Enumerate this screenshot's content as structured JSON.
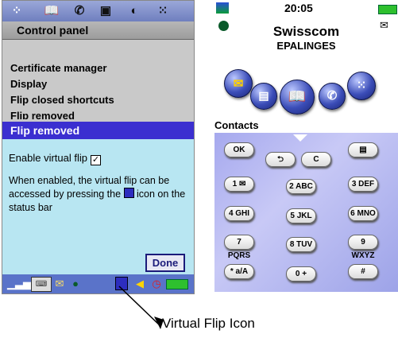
{
  "left_phone": {
    "top_bar_icons": [
      "app-launcher-icon",
      "book-icon",
      "phone-icon",
      "calendar-icon",
      "globe-icon",
      "grid-icon"
    ],
    "title": "Control panel",
    "menu_items": [
      "Certificate manager",
      "Display",
      "Flip closed shortcuts",
      "Flip removed"
    ],
    "dialog": {
      "title": "Flip removed",
      "enable_label": "Enable virtual flip",
      "enable_checked": true,
      "description_part1": "When enabled, the virtual flip can be accessed by pressing the",
      "description_part2": "icon on the status bar",
      "done_label": "Done"
    },
    "status_icons": [
      "signal-icon",
      "keyboard-icon",
      "email-icon",
      "globe-icon",
      "virtual-flip-icon",
      "sound-icon",
      "clock-icon",
      "battery-icon"
    ]
  },
  "right_phone": {
    "time": "20:05",
    "provider": "Swisscom",
    "location": "EPALINGES",
    "apps": [
      "messages-icon",
      "contacts-card-icon",
      "book-icon",
      "phone-icon",
      "grid-icon"
    ],
    "section_label": "Contacts",
    "keys": [
      {
        "label": "OK"
      },
      {
        "label": "⮌"
      },
      {
        "label": "C"
      },
      {
        "label": "▤"
      },
      {
        "label": "1 ✉"
      },
      {
        "label": "2 ABC"
      },
      {
        "label": "3 DEF"
      },
      {
        "label": "4 GHI"
      },
      {
        "label": "5 JKL"
      },
      {
        "label": "6 MNO"
      },
      {
        "label": "7 PQRS"
      },
      {
        "label": "8 TUV"
      },
      {
        "label": "9 WXYZ"
      },
      {
        "label": "* a/A"
      },
      {
        "label": "0 +"
      },
      {
        "label": "#"
      }
    ]
  },
  "annotation": {
    "label": "Virtual Flip Icon"
  }
}
